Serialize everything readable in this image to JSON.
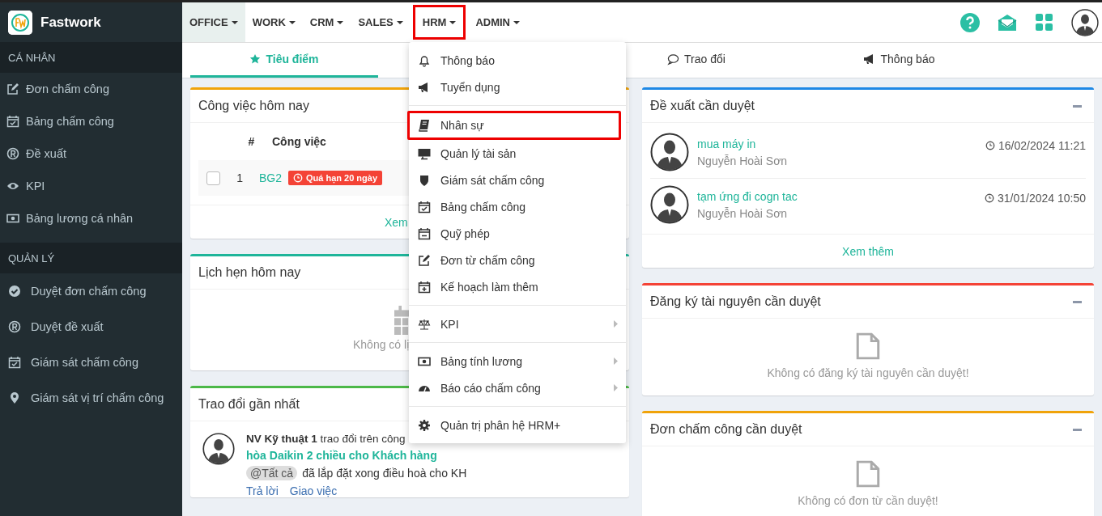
{
  "app": {
    "name": "Fastwork"
  },
  "sidebar": [
    {
      "title": "CÁ NHÂN",
      "items": [
        {
          "label": "Đơn chấm công"
        },
        {
          "label": "Bảng chấm công"
        },
        {
          "label": "Đề xuất"
        },
        {
          "label": "KPI"
        },
        {
          "label": "Bảng lương cá nhân"
        }
      ]
    },
    {
      "title": "QUẢN LÝ",
      "items": [
        {
          "label": "Duyệt đơn chấm công"
        },
        {
          "label": "Duyệt đề xuất"
        },
        {
          "label": "Giám sát chấm công"
        },
        {
          "label": "Giám sát vị trí chấm công"
        }
      ]
    }
  ],
  "nav": [
    {
      "label": "OFFICE",
      "selected": true,
      "highlighted": false
    },
    {
      "label": "WORK",
      "selected": false,
      "highlighted": false
    },
    {
      "label": "CRM",
      "selected": false,
      "highlighted": false
    },
    {
      "label": "SALES",
      "selected": false,
      "highlighted": false
    },
    {
      "label": "HRM",
      "selected": false,
      "highlighted": true
    },
    {
      "label": "ADMIN",
      "selected": false,
      "highlighted": false
    }
  ],
  "tabs": [
    {
      "label": "Tiêu điểm",
      "selected": true
    },
    {
      "label": "Trao đổi",
      "selected": false
    },
    {
      "label": "Thông báo",
      "selected": false
    }
  ],
  "left_column": [
    {
      "kind": "tasks",
      "title": "Công việc hôm nay",
      "color": "#f0a30a",
      "columns": [
        "#",
        "Công việc"
      ],
      "rows": [
        {
          "checked": false,
          "number": "1",
          "task": "BG2",
          "badge": "Quá hạn 20 ngày"
        }
      ],
      "more": "Xem"
    },
    {
      "kind": "appointments",
      "title": "Lịch hẹn hôm nay",
      "color": "#1fb59a",
      "empty": "Không có lị"
    },
    {
      "kind": "discussion",
      "title": "Trao đổi gần nhất",
      "color": "#4cb848",
      "posts": [
        {
          "header": "**NV Kỹ thuật 1** trao đổi trên công",
          "task": "hòa Daikin 2 chiều cho Khách hàng",
          "mention": "@Tất cả",
          "message": "đã lắp đặt xong điều hoà cho KH",
          "actions": [
            "Trả lời",
            "Giao việc"
          ]
        }
      ]
    }
  ],
  "right_column": [
    {
      "kind": "proposals",
      "title": "Đề xuất cần duyệt",
      "color": "#1e88e5",
      "items": [
        {
          "title": "mua máy in",
          "author": "Nguyễn Hoài Sơn",
          "time": "16/02/2024 11:21"
        },
        {
          "title": "tạm ứng đi cogn tac",
          "author": "Nguyễn Hoài Sơn",
          "time": "31/01/2024 10:50"
        }
      ],
      "more": "Xem thêm"
    },
    {
      "kind": "empty",
      "title": "Đăng ký tài nguyên cần duyệt",
      "color": "#f44336",
      "empty": "Không có đăng ký tài nguyên cần duyệt!"
    },
    {
      "kind": "empty",
      "title": "Đơn chấm công cần duyệt",
      "color": "#f0a30a",
      "empty": "Không có đơn từ cần duyệt!"
    }
  ],
  "hrm_menu": {
    "groups": [
      {
        "items": [
          {
            "label": "Thông báo",
            "submenu": false,
            "highlighted": false
          },
          {
            "label": "Tuyển dụng",
            "submenu": false,
            "highlighted": false
          }
        ]
      },
      {
        "items": [
          {
            "label": "Nhân sự",
            "submenu": false,
            "highlighted": true
          },
          {
            "label": "Quản lý tài sản",
            "submenu": false,
            "highlighted": false
          },
          {
            "label": "Giám sát chấm công",
            "submenu": false,
            "highlighted": false
          },
          {
            "label": "Bảng chấm công",
            "submenu": false,
            "highlighted": false
          },
          {
            "label": "Quỹ phép",
            "submenu": false,
            "highlighted": false
          },
          {
            "label": "Đơn từ chấm công",
            "submenu": false,
            "highlighted": false
          },
          {
            "label": "Kế hoạch làm thêm",
            "submenu": false,
            "highlighted": false
          }
        ]
      },
      {
        "items": [
          {
            "label": "KPI",
            "submenu": true,
            "highlighted": false
          }
        ]
      },
      {
        "items": [
          {
            "label": "Bảng tính lương",
            "submenu": true,
            "highlighted": false
          },
          {
            "label": "Báo cáo chấm công",
            "submenu": true,
            "highlighted": false
          }
        ]
      },
      {
        "items": [
          {
            "label": "Quản trị phân hệ HRM+",
            "submenu": false,
            "highlighted": false
          }
        ]
      }
    ]
  }
}
